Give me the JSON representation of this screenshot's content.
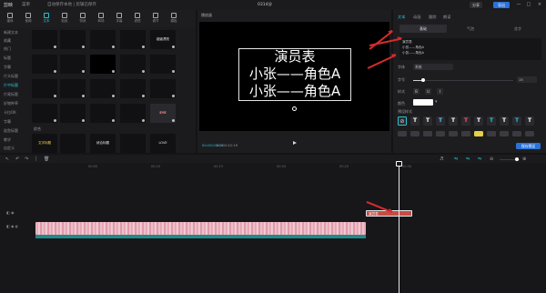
{
  "titlebar": {
    "logo": "剪映",
    "menu": "菜单",
    "status": "自动保存本地 | 剪辑已保存",
    "title": "0314分",
    "share": "分享",
    "export": "导出",
    "window_controls": [
      "—",
      "□",
      "×"
    ]
  },
  "media_tools": [
    {
      "label": "媒体",
      "icon": "media-icon"
    },
    {
      "label": "音频",
      "icon": "audio-icon"
    },
    {
      "label": "文本",
      "icon": "text-icon",
      "active": true
    },
    {
      "label": "贴纸",
      "icon": "sticker-icon"
    },
    {
      "label": "特效",
      "icon": "effect-icon"
    },
    {
      "label": "转场",
      "icon": "transition-icon"
    },
    {
      "label": "字幕",
      "icon": "caption-icon"
    },
    {
      "label": "滤镜",
      "icon": "filter-icon"
    },
    {
      "label": "调节",
      "icon": "adjust-icon"
    },
    {
      "label": "模板",
      "icon": "template-icon"
    }
  ],
  "categories": [
    "新建文本",
    "收藏",
    "热门",
    "标题",
    "字幕",
    "片头标题",
    "片中标题",
    "片尾标题",
    "好物种草",
    "卡拉OK",
    "字幕",
    "鲨鱼标题",
    "教学",
    "自定义"
  ],
  "active_category_index": 6,
  "grid_section_label": "综合",
  "templates": [
    "",
    "",
    "",
    "",
    "超级漂亮",
    "",
    "",
    "",
    "",
    "",
    "",
    "",
    "",
    "",
    "",
    "",
    "",
    "",
    "",
    "",
    "EYE",
    "",
    "",
    "",
    "",
    "文字标题",
    "",
    "综合标题",
    "",
    "LOVE"
  ],
  "player": {
    "title": "播放器",
    "canvas_lines": [
      "演员表",
      "小张——角色A",
      "小张——角色A"
    ],
    "time_current": "00:00:00:00",
    "time_total": "00:00:22:19"
  },
  "inspector": {
    "tabs": [
      "文本",
      "动画",
      "跟踪",
      "朗读"
    ],
    "active_tab": 0,
    "subtabs": [
      "基础",
      "气泡",
      "花字"
    ],
    "active_subtab": 0,
    "text_lines": [
      "演员表",
      "小张——角色A",
      "小张——角色A"
    ],
    "font_label": "字体",
    "font_value": "系统",
    "size_label": "字号",
    "size_value": "15",
    "size_fraction": 0.1,
    "style_label": "样式",
    "style_buttons": [
      "B",
      "U",
      "I"
    ],
    "color_label": "颜色",
    "preset_label": "预设样式",
    "presets": [
      "T",
      "T",
      "T",
      "T",
      "T",
      "T",
      "T",
      "T",
      "T",
      "T",
      "T"
    ],
    "preset_colors": [
      "#d8d8dc",
      "#ffffff",
      "#ffffff",
      "#4fc3f7",
      "#ffffff",
      "#ff4d6d",
      "#ffffff",
      "#27c3d2",
      "#ffffff",
      "#2db3e6",
      "#ffffff"
    ],
    "preset2_colors": [
      "#3a3a40",
      "#3a3a40",
      "#3a3a40",
      "#3a3a40",
      "#3a3a40",
      "#3a3a40",
      "#e4d04a",
      "#3a3a40",
      "#3a3a40",
      "#3a3a40",
      "#3a3a40"
    ],
    "save_preset": "保存预设"
  },
  "timeline": {
    "ruler": [
      "00:00",
      "00:05",
      "00:10",
      "00:15",
      "00:20",
      "00:25",
      "00:30"
    ],
    "text_clip_label": "演员表"
  },
  "colors": {
    "accent": "#27c3d2",
    "export": "#2a72d8",
    "text_clip": "#c64c46",
    "audio_clip": "#1f8a8a",
    "annotation": "#d92b2b"
  }
}
